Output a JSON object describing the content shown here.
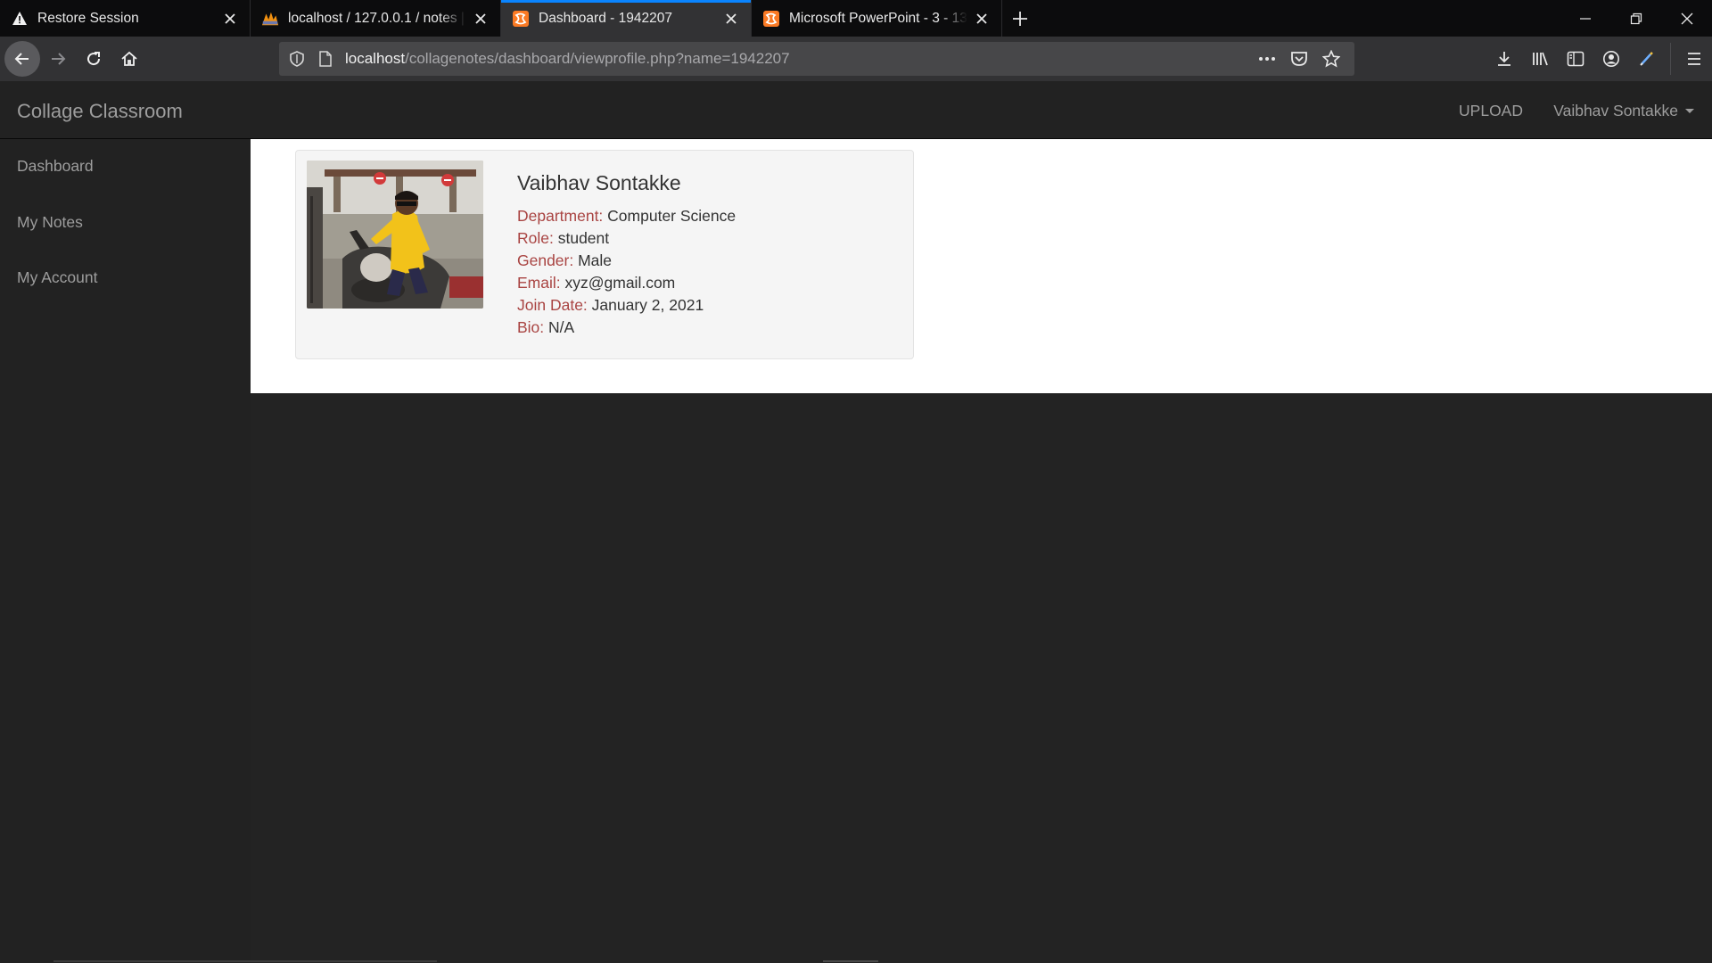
{
  "browser": {
    "tabs": [
      {
        "title": "Restore Session",
        "icon": "warning-icon"
      },
      {
        "title": "localhost / 127.0.0.1 / notes | phpMyAdmin",
        "icon": "phpmyadmin-icon"
      },
      {
        "title": "Dashboard - 1942207",
        "icon": "xampp-icon",
        "active": true
      },
      {
        "title": "Microsoft PowerPoint - 3 - 1369",
        "icon": "xampp-icon"
      }
    ],
    "url_host": "localhost",
    "url_path": "/collagenotes/dashboard/viewprofile.php?name=1942207"
  },
  "header": {
    "brand": "Collage Classroom",
    "upload_label": "UPLOAD",
    "user_name": "Vaibhav Sontakke"
  },
  "sidebar": {
    "items": [
      {
        "label": "Dashboard"
      },
      {
        "label": "My Notes"
      },
      {
        "label": "My Account"
      }
    ]
  },
  "profile": {
    "name": "Vaibhav Sontakke",
    "fields": [
      {
        "key": "Department:",
        "value": "Computer Science"
      },
      {
        "key": "Role:",
        "value": "student"
      },
      {
        "key": "Gender:",
        "value": "Male"
      },
      {
        "key": "Email:",
        "value": "xyz@gmail.com"
      },
      {
        "key": "Join Date:",
        "value": "January 2, 2021"
      },
      {
        "key": "Bio:",
        "value": "N/A"
      }
    ]
  },
  "colors": {
    "accent_tab": "#0a84ff",
    "field_key": "#a94442",
    "nav_bg": "#222222"
  }
}
